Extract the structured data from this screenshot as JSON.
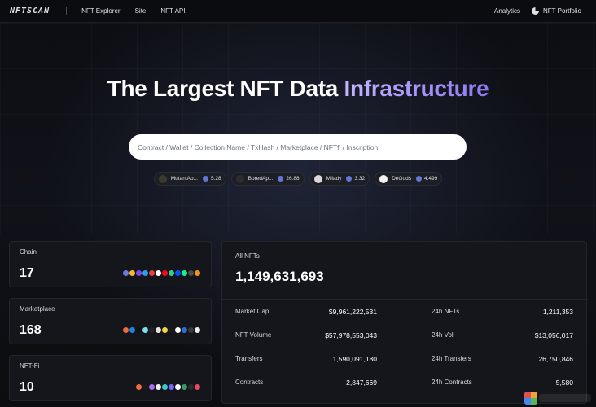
{
  "nav": {
    "logo": "NFTSCAN",
    "links": [
      "NFT Explorer",
      "Site",
      "NFT API"
    ],
    "right_links": [
      "Analytics",
      "NFT Portfolio"
    ]
  },
  "hero": {
    "headline_main": "The Largest NFT Data ",
    "headline_accent": "Infrastructure",
    "search_placeholder": "Contract / Wallet / Collection Name / TxHash / Marketplace / NFTfi / Inscription"
  },
  "chips": [
    {
      "name": "MutantAp...",
      "price": "5.28",
      "color": "#2a2c1e"
    },
    {
      "name": "BoredAp...",
      "price": "26.88",
      "color": "#2c2c2c"
    },
    {
      "name": "Milady",
      "price": "3.32",
      "color": "#d9d9d9"
    },
    {
      "name": "DeGods",
      "price": "4.499",
      "color": "#f2f2f2"
    }
  ],
  "summary_cards": [
    {
      "label": "Chain",
      "value": "17"
    },
    {
      "label": "Marketplace",
      "value": "168"
    },
    {
      "label": "NFT-Fi",
      "value": "10"
    }
  ],
  "overview": {
    "all_label": "All NFTs",
    "all_value": "1,149,631,693",
    "left_stats": [
      {
        "label": "Market Cap",
        "value": "$9,961,222,531"
      },
      {
        "label": "NFT Volume",
        "value": "$57,978,553,043"
      },
      {
        "label": "Transfers",
        "value": "1,590,091,180"
      },
      {
        "label": "Contracts",
        "value": "2,847,669"
      }
    ],
    "right_stats": [
      {
        "label": "24h NFTs",
        "value": "1,211,353"
      },
      {
        "label": "24h Vol",
        "value": "$13,056,017"
      },
      {
        "label": "24h Transfers",
        "value": "26,750,846"
      },
      {
        "label": "24h Contracts",
        "value": "5,580"
      }
    ]
  },
  "colors": {
    "accent": "#9d8cf6",
    "background": "#0c0d10",
    "card": "#15161b",
    "eth": "#6476d9"
  }
}
